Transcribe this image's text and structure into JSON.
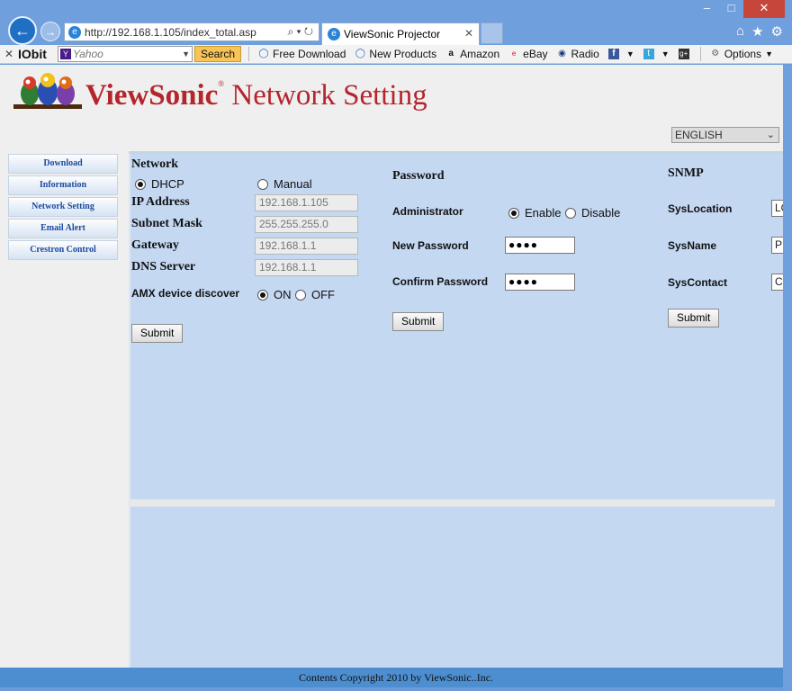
{
  "browser": {
    "window_controls": [
      "–",
      "□",
      "✕"
    ],
    "address": "http://192.168.1.105/index_total.asp",
    "address_actions": "⌕ ▾ ↻",
    "tab_title": "ViewSonic Projector",
    "tab_close": "✕",
    "right_icons": [
      "⌂",
      "★",
      "⚙"
    ]
  },
  "toolbar": {
    "close": "✕",
    "brand": "IObit",
    "search_placeholder": "Yahoo",
    "search_button": "Search",
    "links": [
      "Free Download",
      "New Products",
      "Amazon",
      "eBay",
      "Radio"
    ],
    "options": "Options"
  },
  "header": {
    "brand_bold": "ViewSonic",
    "brand_mark": "®",
    "brand_rest": " Network Setting",
    "language": "ENGLISH"
  },
  "sidebar": {
    "items": [
      {
        "label": "Download"
      },
      {
        "label": "Information"
      },
      {
        "label": "Network Setting"
      },
      {
        "label": "Email Alert"
      },
      {
        "label": "Crestron Control"
      }
    ]
  },
  "network": {
    "title": "Network",
    "mode_dhcp": "DHCP",
    "mode_manual": "Manual",
    "selected_mode": "DHCP",
    "ip_label": "IP Address",
    "ip_value": "192.168.1.105",
    "subnet_label": "Subnet Mask",
    "subnet_value": "255.255.255.0",
    "gateway_label": "Gateway",
    "gateway_value": "192.168.1.1",
    "dns_label": "DNS Server",
    "dns_value": "192.168.1.1",
    "amx_label": "AMX device discover",
    "amx_on": "ON",
    "amx_off": "OFF",
    "amx_selected": "ON",
    "submit": "Submit"
  },
  "password": {
    "title": "Password",
    "admin_label": "Administrator",
    "enable": "Enable",
    "disable": "Disable",
    "selected": "Enable",
    "new_label": "New Password",
    "new_value": "●●●●",
    "confirm_label": "Confirm Password",
    "confirm_value": "●●●●",
    "submit": "Submit"
  },
  "snmp": {
    "title": "SNMP",
    "location_label": "SysLocation",
    "location_value": "LO",
    "name_label": "SysName",
    "name_value": "PR",
    "contact_label": "SysContact",
    "contact_value": "CO",
    "submit": "Submit"
  },
  "footer": {
    "text": "Contents Copyright 2010 by ViewSonic..Inc."
  }
}
